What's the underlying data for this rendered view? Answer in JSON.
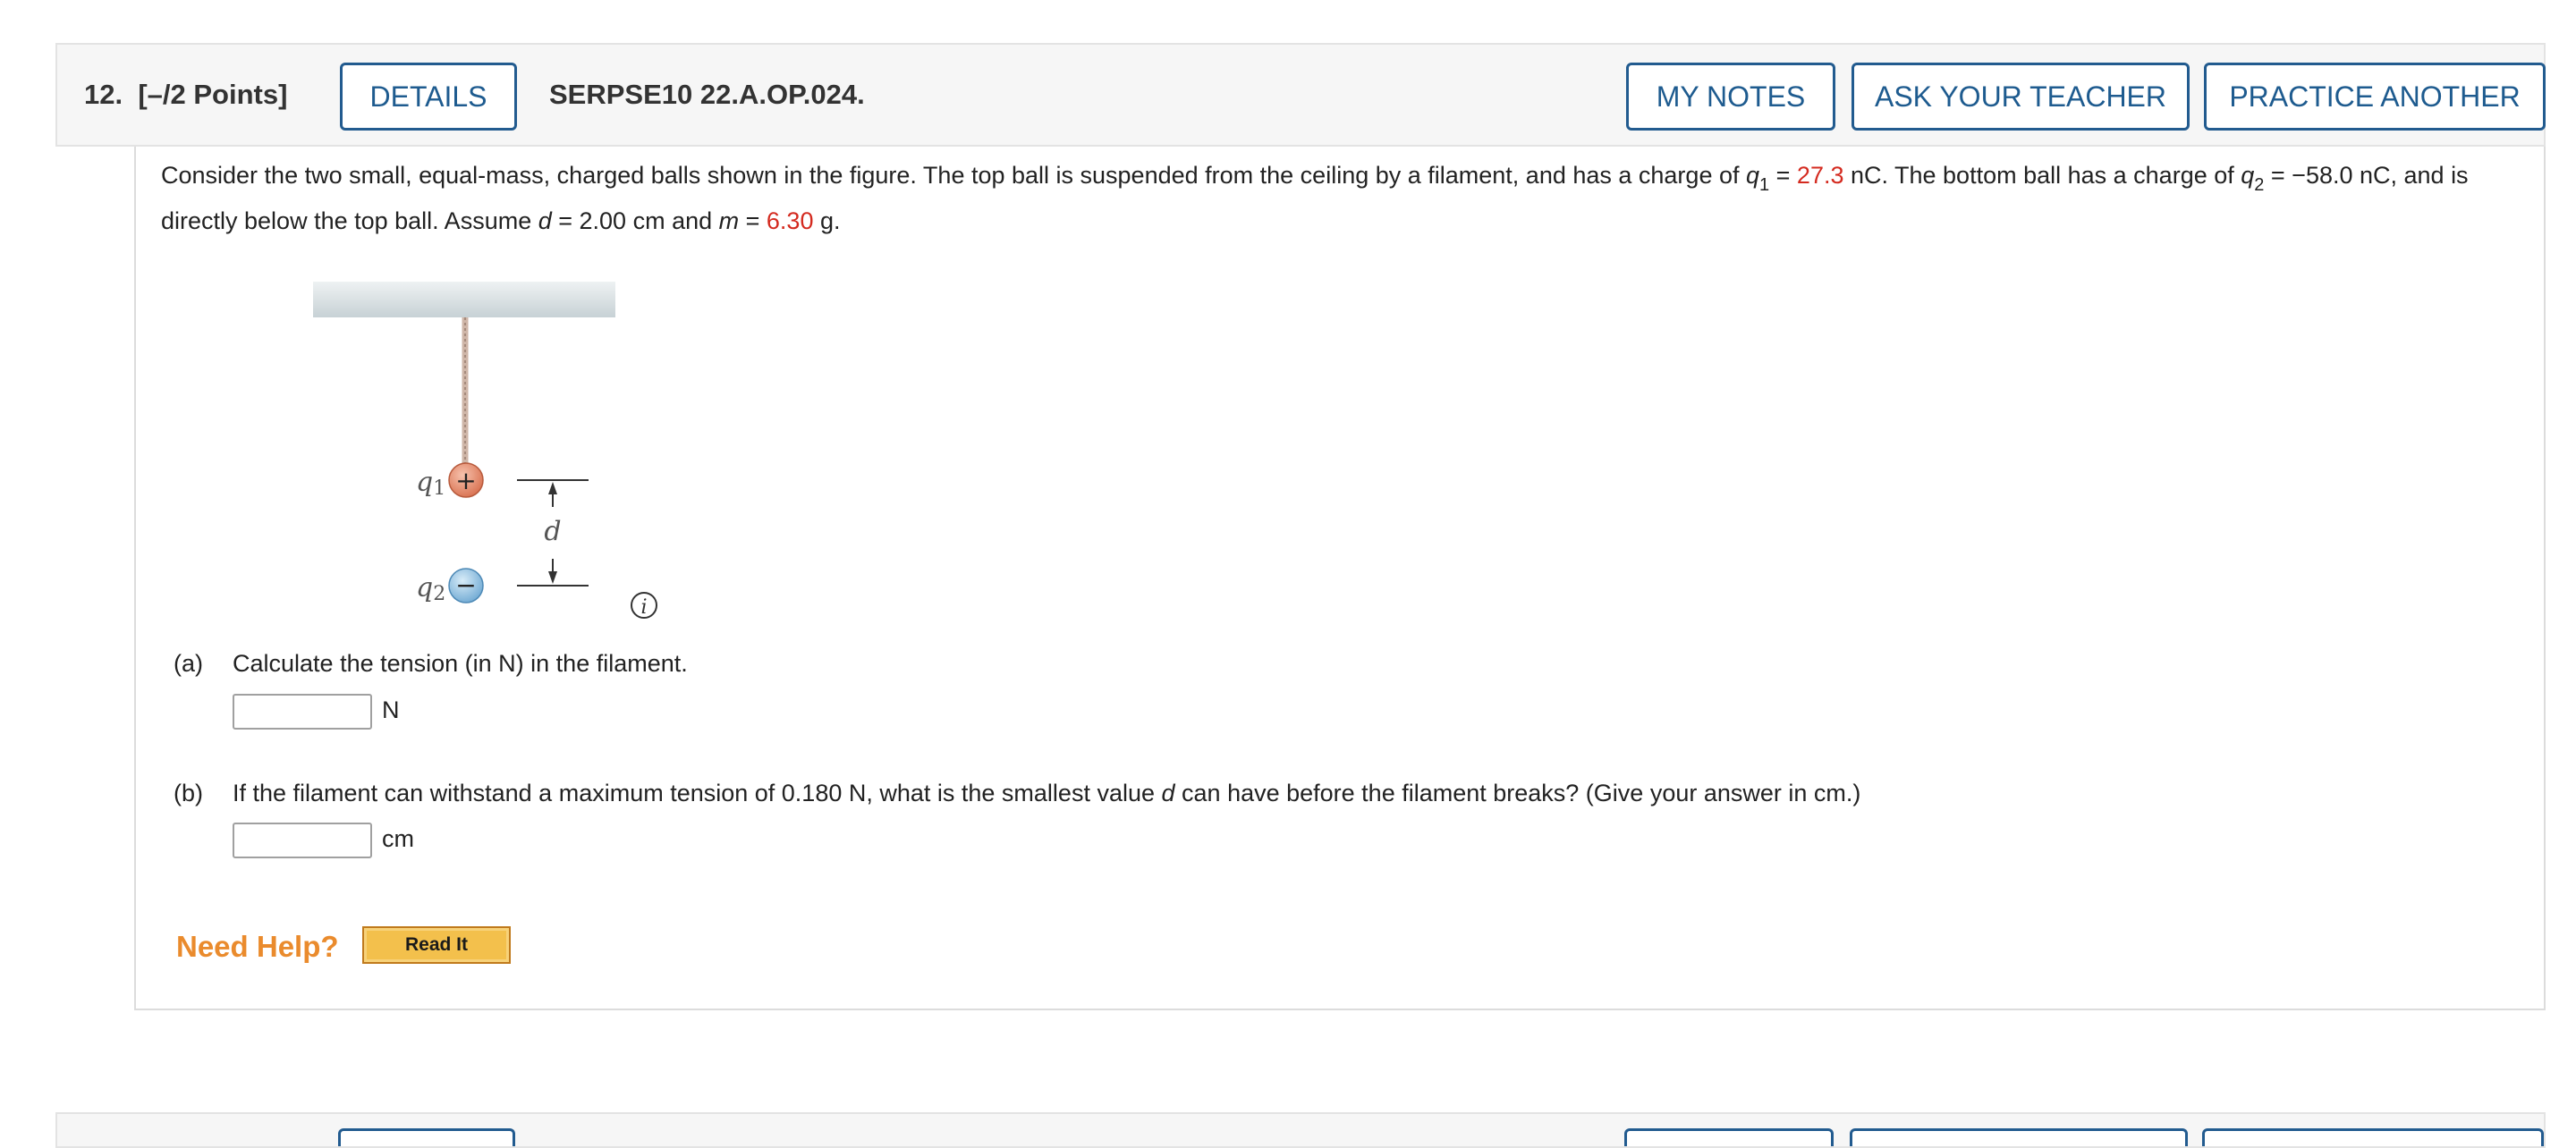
{
  "header": {
    "number": "12.",
    "points": "[–/2 Points]",
    "details_label": "DETAILS",
    "code": "SERPSE10 22.A.OP.024.",
    "my_notes_label": "MY NOTES",
    "ask_teacher_label": "ASK YOUR TEACHER",
    "practice_label": "PRACTICE ANOTHER"
  },
  "problem": {
    "t1": "Consider the two small, equal-mass, charged balls shown in the figure. The top ball is suspended from the ceiling by a filament, and has a charge of ",
    "q1_var": "q",
    "q1_sub": "1",
    "eq1": " = ",
    "q1_value": "27.3",
    "t2": " nC. The bottom ball has a charge of ",
    "q2_var": "q",
    "q2_sub": "2",
    "t3": " = −58.0 nC, and is directly below the top ball. Assume ",
    "d_var": "d",
    "t4": " = 2.00 cm and ",
    "m_var": "m",
    "eq2": " = ",
    "m_value": "6.30",
    "t5": " g."
  },
  "figure": {
    "q1_label": "q",
    "q1_sub": "1",
    "q2_label": "q",
    "q2_sub": "2",
    "d_label": "d",
    "plus_sign": "+",
    "minus_sign": "−",
    "info_icon": "info-icon"
  },
  "part_a": {
    "label": "(a)",
    "text": "Calculate the tension (in N) in the filament.",
    "value": "",
    "unit": "N"
  },
  "part_b": {
    "label": "(b)",
    "text_before": "If the filament can withstand a maximum tension of 0.180 N, what is the smallest value ",
    "d_var": "d",
    "text_after": " can have before the filament breaks? (Give your answer in cm.)",
    "value": "",
    "unit": "cm"
  },
  "help": {
    "need_help": "Need Help?",
    "read_it": "Read It"
  },
  "colors": {
    "accent": "#225b8f",
    "highlight": "#d42a1f",
    "help_orange": "#ea8b2d",
    "read_it_fill": "#f3c04c"
  }
}
